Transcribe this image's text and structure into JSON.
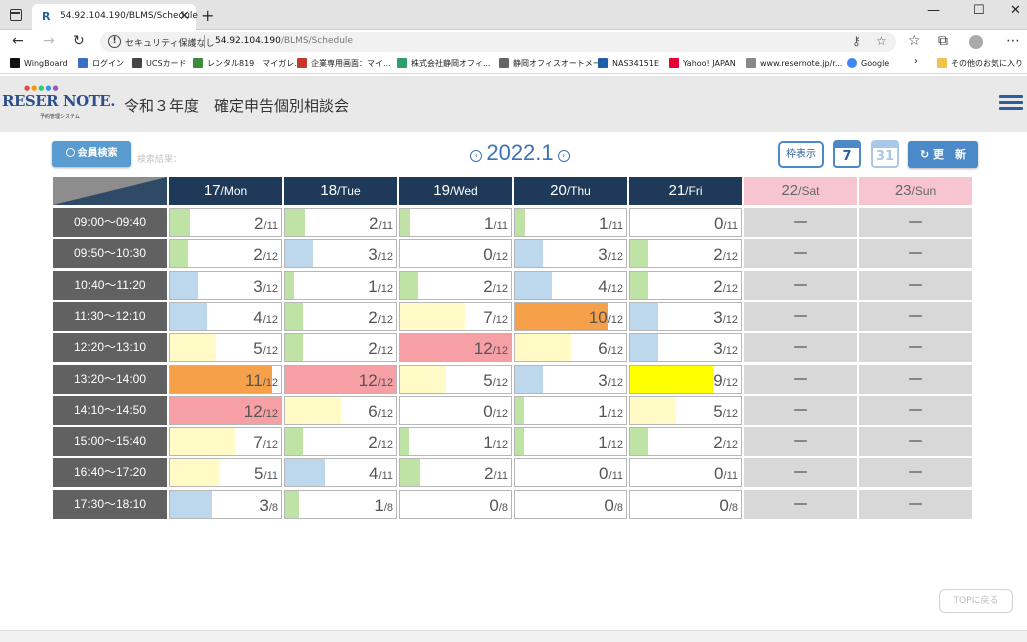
{
  "browser": {
    "tab_title": "54.92.104.190/BLMS/Schedule",
    "security_text": "セキュリティ保護なし",
    "url_host": "54.92.104.190",
    "url_path": "/BLMS/Schedule",
    "bookmarks": [
      {
        "label": "WingBoard",
        "color": "#111111"
      },
      {
        "label": "ログイン",
        "color": "#3a6fc4"
      },
      {
        "label": "UCSカード",
        "color": "#444444"
      },
      {
        "label": "レンタル819　マイガレ...",
        "color": "#3d8b3d"
      },
      {
        "label": "企業専用画面：マイ...",
        "color": "#c0392b"
      },
      {
        "label": "株式会社静岡オフィ...",
        "color": "#2e9e6e"
      },
      {
        "label": "静岡オフィスオートメー...",
        "color": "#666666"
      },
      {
        "label": "NAS34151E",
        "color": "#1e5fa8"
      },
      {
        "label": "Yahoo! JAPAN",
        "color": "#e60033"
      },
      {
        "label": "www.resernote.jp/r...",
        "color": "#888888"
      },
      {
        "label": "Google",
        "color": "#4285f4"
      }
    ],
    "other_favorites": "その他のお気に入り"
  },
  "header": {
    "logo_text": "RESER NOTE.",
    "logo_sub": "予約管理システム",
    "title": "令和３年度　確定申告個別相談会"
  },
  "toolbar": {
    "member_search": "会員検索",
    "search_result": "検索結果：",
    "period": "2022.1",
    "frame_view": "枠表示",
    "cal_week": "7",
    "cal_month": "31",
    "refresh": "更　新"
  },
  "days": [
    {
      "num": "17",
      "dow": "/Mon",
      "weekend": false
    },
    {
      "num": "18",
      "dow": "/Tue",
      "weekend": false
    },
    {
      "num": "19",
      "dow": "/Wed",
      "weekend": false
    },
    {
      "num": "20",
      "dow": "/Thu",
      "weekend": false
    },
    {
      "num": "21",
      "dow": "/Fri",
      "weekend": false
    },
    {
      "num": "22",
      "dow": "/Sat",
      "weekend": true
    },
    {
      "num": "23",
      "dow": "/Sun",
      "weekend": true
    }
  ],
  "closed_mark": "—",
  "slots": [
    {
      "time": "09:00～09:40",
      "cells": [
        [
          2,
          11
        ],
        [
          2,
          11
        ],
        [
          1,
          11
        ],
        [
          1,
          11
        ],
        [
          0,
          11
        ]
      ]
    },
    {
      "time": "09:50～10:30",
      "cells": [
        [
          2,
          12
        ],
        [
          3,
          12
        ],
        [
          0,
          12
        ],
        [
          3,
          12
        ],
        [
          2,
          12
        ]
      ]
    },
    {
      "time": "10:40～11:20",
      "cells": [
        [
          3,
          12
        ],
        [
          1,
          12
        ],
        [
          2,
          12
        ],
        [
          4,
          12
        ],
        [
          2,
          12
        ]
      ]
    },
    {
      "time": "11:30～12:10",
      "cells": [
        [
          4,
          12
        ],
        [
          2,
          12
        ],
        [
          7,
          12
        ],
        [
          10,
          12
        ],
        [
          3,
          12
        ]
      ]
    },
    {
      "time": "12:20～13:10",
      "cells": [
        [
          5,
          12
        ],
        [
          2,
          12
        ],
        [
          12,
          12
        ],
        [
          6,
          12
        ],
        [
          3,
          12
        ]
      ]
    },
    {
      "time": "13:20～14:00",
      "cells": [
        [
          11,
          12
        ],
        [
          12,
          12
        ],
        [
          5,
          12
        ],
        [
          3,
          12
        ],
        [
          9,
          12
        ]
      ]
    },
    {
      "time": "14:10～14:50",
      "cells": [
        [
          12,
          12
        ],
        [
          6,
          12
        ],
        [
          0,
          12
        ],
        [
          1,
          12
        ],
        [
          5,
          12
        ]
      ]
    },
    {
      "time": "15:00～15:40",
      "cells": [
        [
          7,
          12
        ],
        [
          2,
          12
        ],
        [
          1,
          12
        ],
        [
          1,
          12
        ],
        [
          2,
          12
        ]
      ]
    },
    {
      "time": "16:40～17:20",
      "cells": [
        [
          5,
          11
        ],
        [
          4,
          11
        ],
        [
          2,
          11
        ],
        [
          0,
          11
        ],
        [
          0,
          11
        ]
      ]
    },
    {
      "time": "17:30～18:10",
      "cells": [
        [
          3,
          8
        ],
        [
          1,
          8
        ],
        [
          0,
          8
        ],
        [
          0,
          8
        ],
        [
          0,
          8
        ]
      ]
    }
  ],
  "colors": {
    "green": "#bfe3a4",
    "blue": "#bdd7ec",
    "cream": "#fffac6",
    "orange": "#f7a04a",
    "pink": "#f6a0a6",
    "yellow": "#ffff00",
    "header_dark": "#1f3a59",
    "weekend": "#f7c5d0"
  },
  "top_button": "TOPに戻る"
}
